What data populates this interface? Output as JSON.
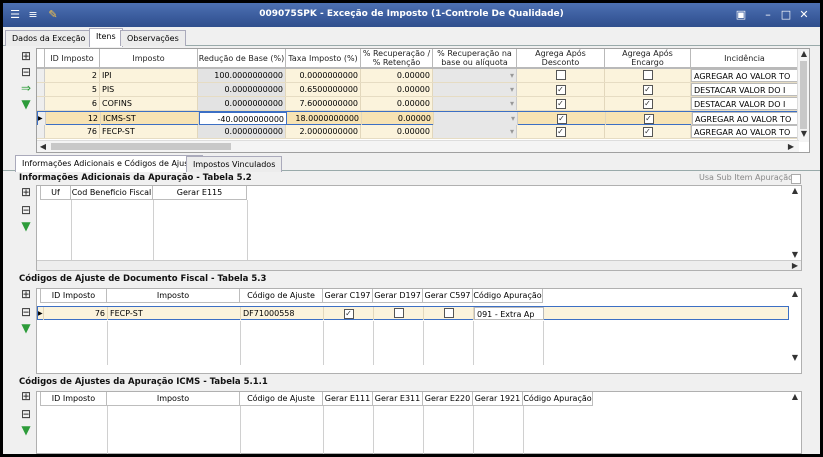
{
  "window": {
    "title": "009075SPK - Exceção de Imposto (1-Controle De Qualidade)"
  },
  "tabs": [
    {
      "label": "Dados da Exceção"
    },
    {
      "label": "Itens"
    },
    {
      "label": "Observações"
    }
  ],
  "items_grid": {
    "headers": [
      "ID Imposto",
      "Imposto",
      "Redução de Base (%)",
      "Taxa Imposto (%)",
      "% Recuperação / % Retenção",
      "% Recuperação na base ou alíquota",
      "Agrega Após Desconto",
      "Agrega Após Encargo",
      "Incidência"
    ],
    "rows": [
      {
        "id": "2",
        "imposto": "IPI",
        "reducao": "100.0000000000",
        "taxa": "0.0000000000",
        "recup": "0.00000",
        "desc": false,
        "enc": false,
        "incid": "AGREGAR AO VALOR TO"
      },
      {
        "id": "5",
        "imposto": "PIS",
        "reducao": "0.0000000000",
        "taxa": "0.6500000000",
        "recup": "0.00000",
        "desc": true,
        "enc": true,
        "incid": "DESTACAR VALOR DO I"
      },
      {
        "id": "6",
        "imposto": "COFINS",
        "reducao": "0.0000000000",
        "taxa": "7.6000000000",
        "recup": "0.00000",
        "desc": true,
        "enc": true,
        "incid": "DESTACAR VALOR DO I"
      },
      {
        "id": "12",
        "imposto": "ICMS-ST",
        "reducao": "-40.0000000000",
        "taxa": "18.0000000000",
        "recup": "0.00000",
        "desc": true,
        "enc": true,
        "incid": "AGREGAR AO VALOR TO"
      },
      {
        "id": "76",
        "imposto": "FECP-ST",
        "reducao": "0.0000000000",
        "taxa": "2.0000000000",
        "recup": "0.00000",
        "desc": true,
        "enc": true,
        "incid": "AGREGAR AO VALOR TO"
      }
    ]
  },
  "subtabs": [
    {
      "label": "Informações Adicionais e Códigos de Ajuste"
    },
    {
      "label": "Impostos Vinculados"
    }
  ],
  "sec1": {
    "title": "Informações Adicionais da Apuração - Tabela 5.2",
    "usa_sub": "Usa Sub Item Apuração",
    "headers": [
      "Uf",
      "Cod Beneficio Fiscal",
      "Gerar E115"
    ]
  },
  "sec2": {
    "title": "Códigos de Ajuste de Documento Fiscal - Tabela 5.3",
    "headers": [
      "ID Imposto",
      "Imposto",
      "Código de Ajuste",
      "Gerar C197",
      "Gerar D197",
      "Gerar C597",
      "Código Apuração"
    ],
    "row": {
      "id": "76",
      "imposto": "FECP-ST",
      "codigo": "DF71000558",
      "c197": true,
      "d197": false,
      "c597": false,
      "apuracao": "091 - Extra Ap"
    }
  },
  "sec3": {
    "title": "Códigos de Ajustes da Apuração ICMS - Tabela 5.1.1",
    "headers": [
      "ID Imposto",
      "Imposto",
      "Código de Ajuste",
      "Gerar E111",
      "Gerar E311",
      "Gerar E220",
      "Gerar 1921",
      "Código Apuração"
    ]
  },
  "icons": {
    "check": "✓",
    "check_color": "#333333",
    "selected_border": "#3c6fc4",
    "row_bg": "#fbf3dc"
  }
}
